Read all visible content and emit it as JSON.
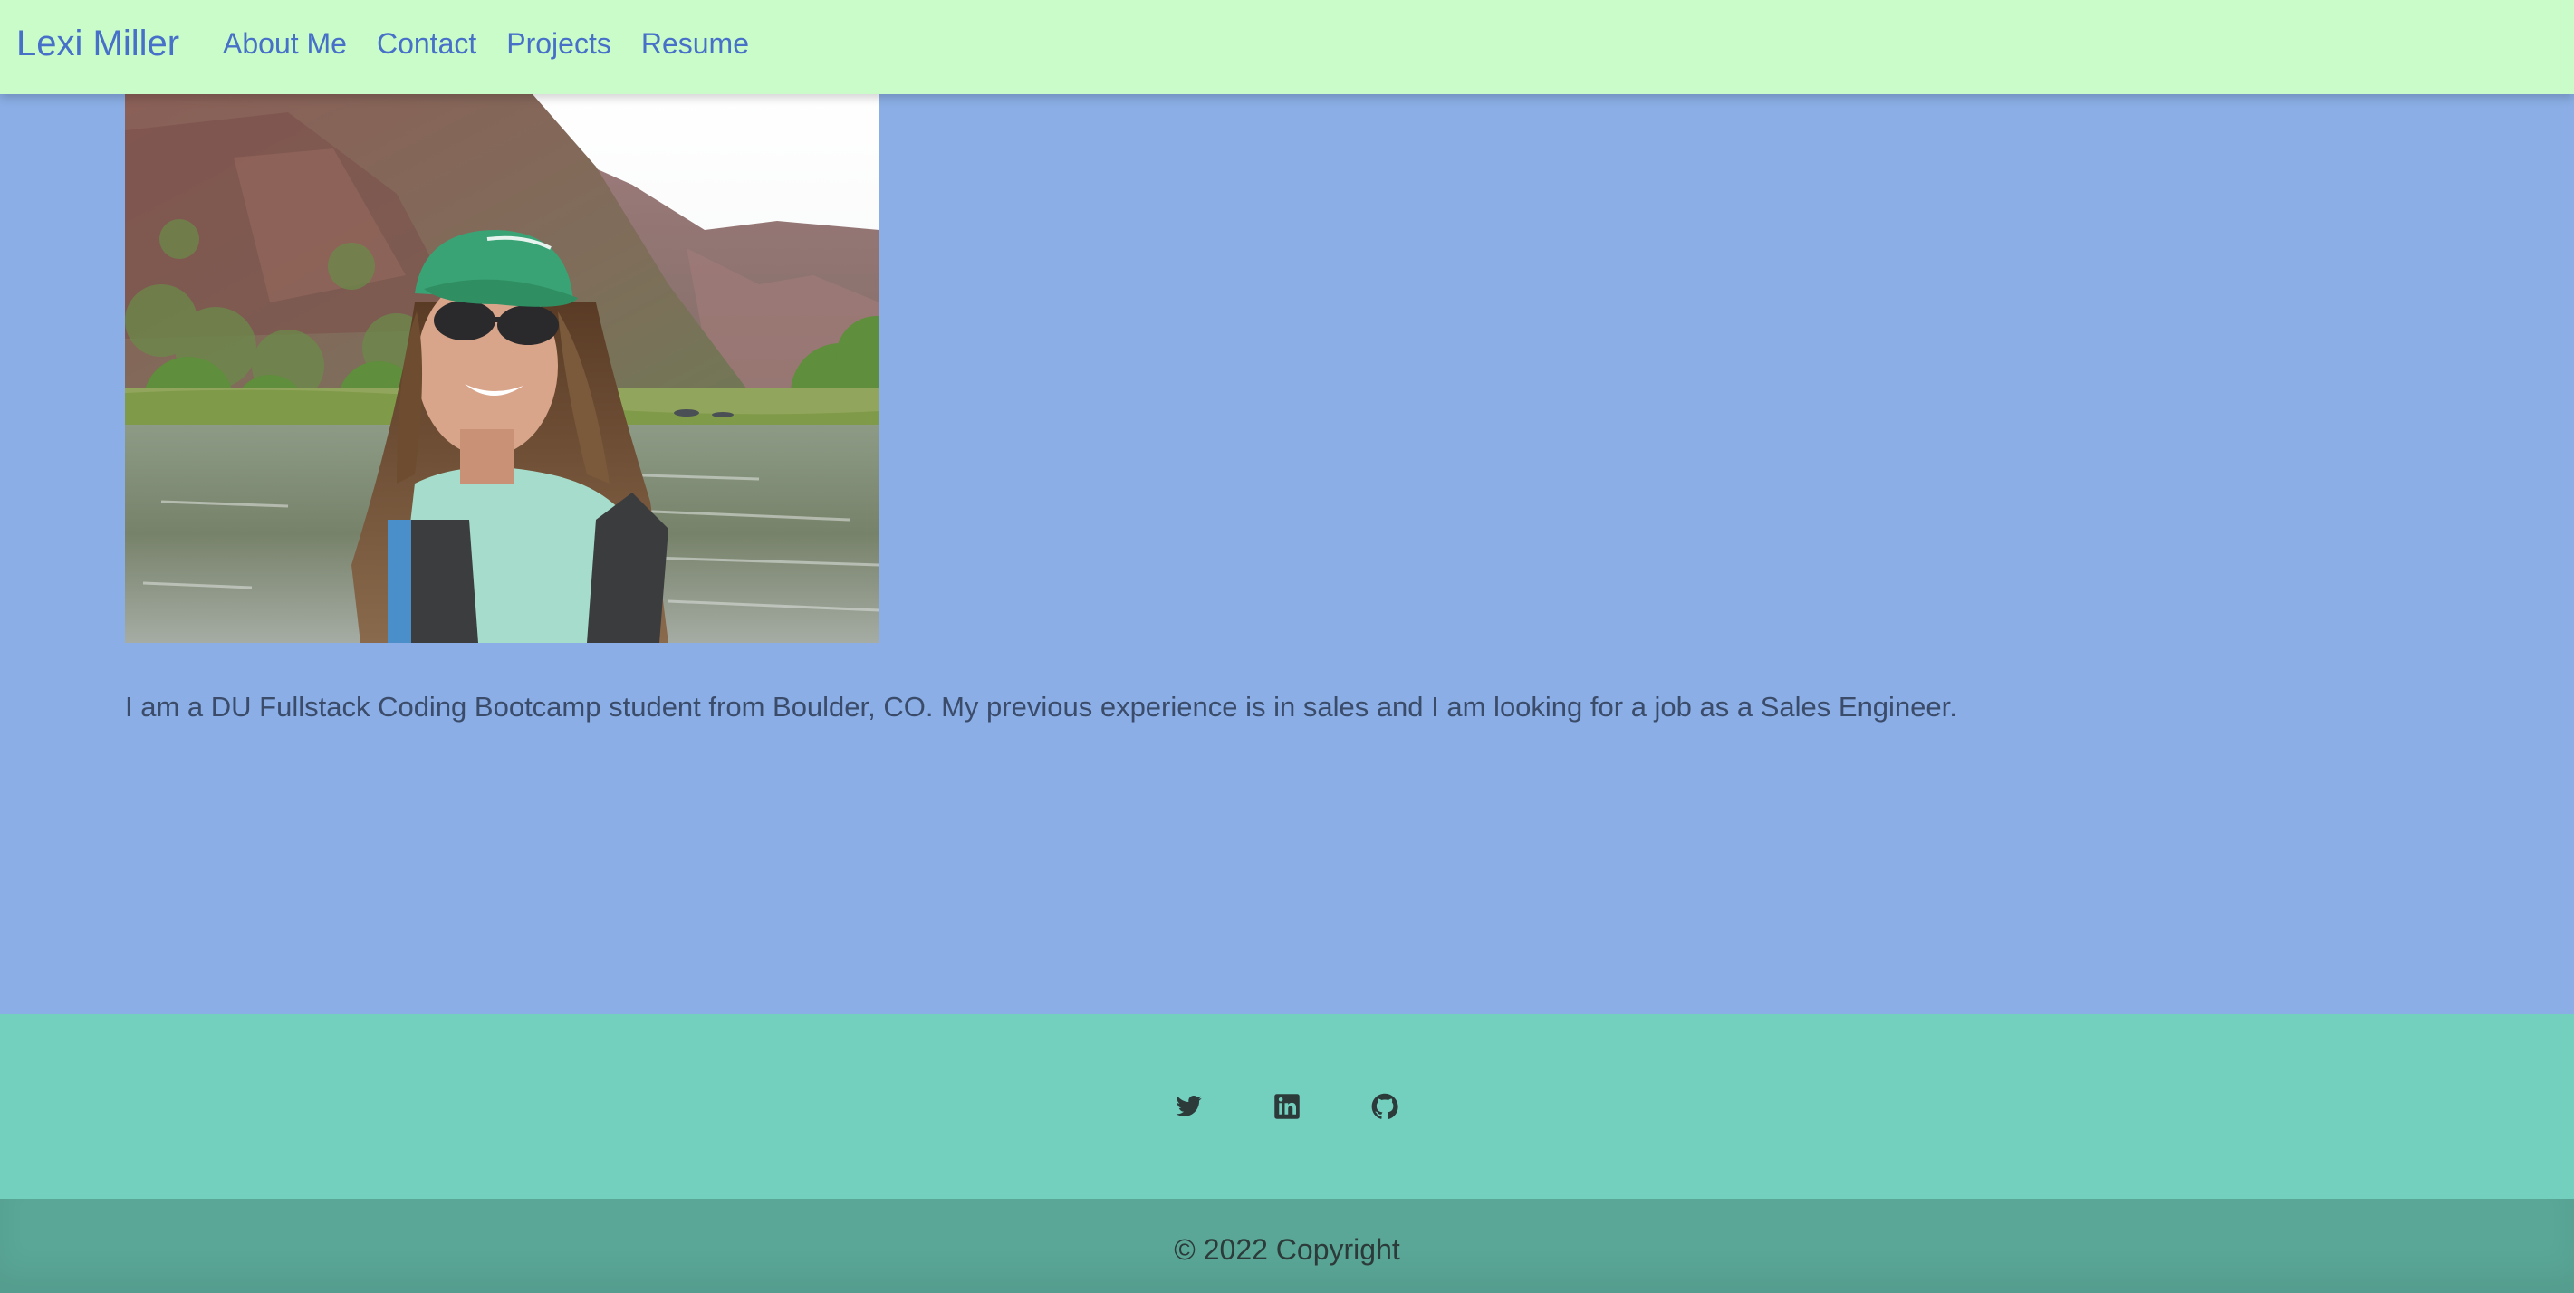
{
  "navbar": {
    "brand": "Lexi Miller",
    "links": [
      "About Me",
      "Contact",
      "Projects",
      "Resume"
    ]
  },
  "main": {
    "photo_alt": "Lexi Miller on a river in a canyon",
    "bio": "I am a DU Fullstack Coding Bootcamp student from Boulder, CO. My previous experience is in sales and I am looking for a job as a Sales Engineer."
  },
  "footer": {
    "social_icons": [
      "twitter-icon",
      "linkedin-icon",
      "github-icon"
    ],
    "copyright": "© 2022 Copyright"
  },
  "colors": {
    "navbar_bg": "#c9fcc9",
    "link": "#4770c9",
    "page_bg": "#8aaee5",
    "social_bg": "#73d0bf",
    "copyright_bg": "#5aa797"
  }
}
